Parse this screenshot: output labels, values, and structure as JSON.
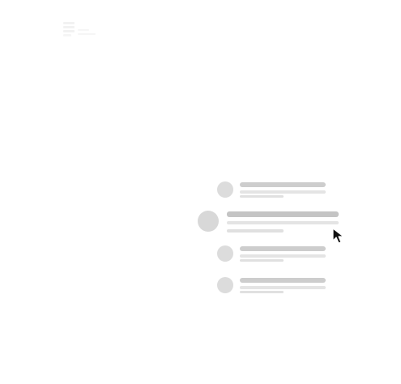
{
  "logo": {
    "icon": "brand-logo-icon",
    "wordmark_lines": [
      "",
      ""
    ]
  },
  "list": {
    "items": [
      {
        "id": "item-1",
        "state": "placeholder"
      },
      {
        "id": "item-2",
        "state": "placeholder-hovered"
      },
      {
        "id": "item-3",
        "state": "placeholder"
      },
      {
        "id": "item-4",
        "state": "placeholder"
      }
    ]
  },
  "cursor": {
    "icon": "mouse-pointer-icon",
    "hovered_item": "item-2"
  },
  "colors": {
    "background": "#ffffff",
    "avatar": "#dcdcdc",
    "title_line": "#cdcdcd",
    "sub_line": "#e4e4e4",
    "cursor": "#111111"
  }
}
